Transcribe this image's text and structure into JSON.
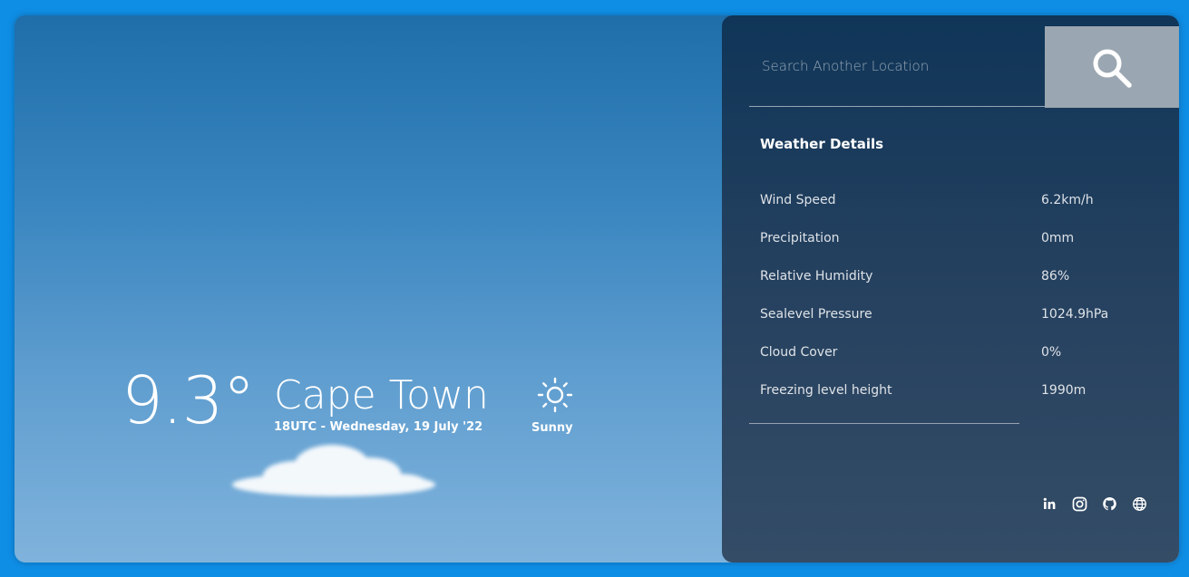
{
  "current": {
    "temperature": "9.3°",
    "city": "Cape Town",
    "datetime": "18UTC - Wednesday, 19 July '22",
    "condition": "Sunny",
    "condition_icon": "sun-icon"
  },
  "search": {
    "placeholder": "Search Another Location",
    "value": "",
    "button_icon": "search-icon"
  },
  "details": {
    "title": "Weather Details",
    "rows": [
      {
        "label": "Wind Speed",
        "value": "6.2km/h"
      },
      {
        "label": "Precipitation",
        "value": "0mm"
      },
      {
        "label": "Relative Humidity",
        "value": "86%"
      },
      {
        "label": "Sealevel Pressure",
        "value": "1024.9hPa"
      },
      {
        "label": "Cloud Cover",
        "value": "0%"
      },
      {
        "label": "Freezing level height",
        "value": "1990m"
      }
    ]
  },
  "social": {
    "icons": [
      "linkedin-icon",
      "instagram-icon",
      "github-icon",
      "globe-icon"
    ]
  },
  "colors": {
    "page_background": "#0f8ee6",
    "sky_top": "#1f6eaa",
    "sky_bottom": "#80b3dc",
    "panel_top": "#0f3558",
    "panel_bottom": "#344c66",
    "search_button": "#9aa6b1",
    "text": "#ffffff"
  }
}
